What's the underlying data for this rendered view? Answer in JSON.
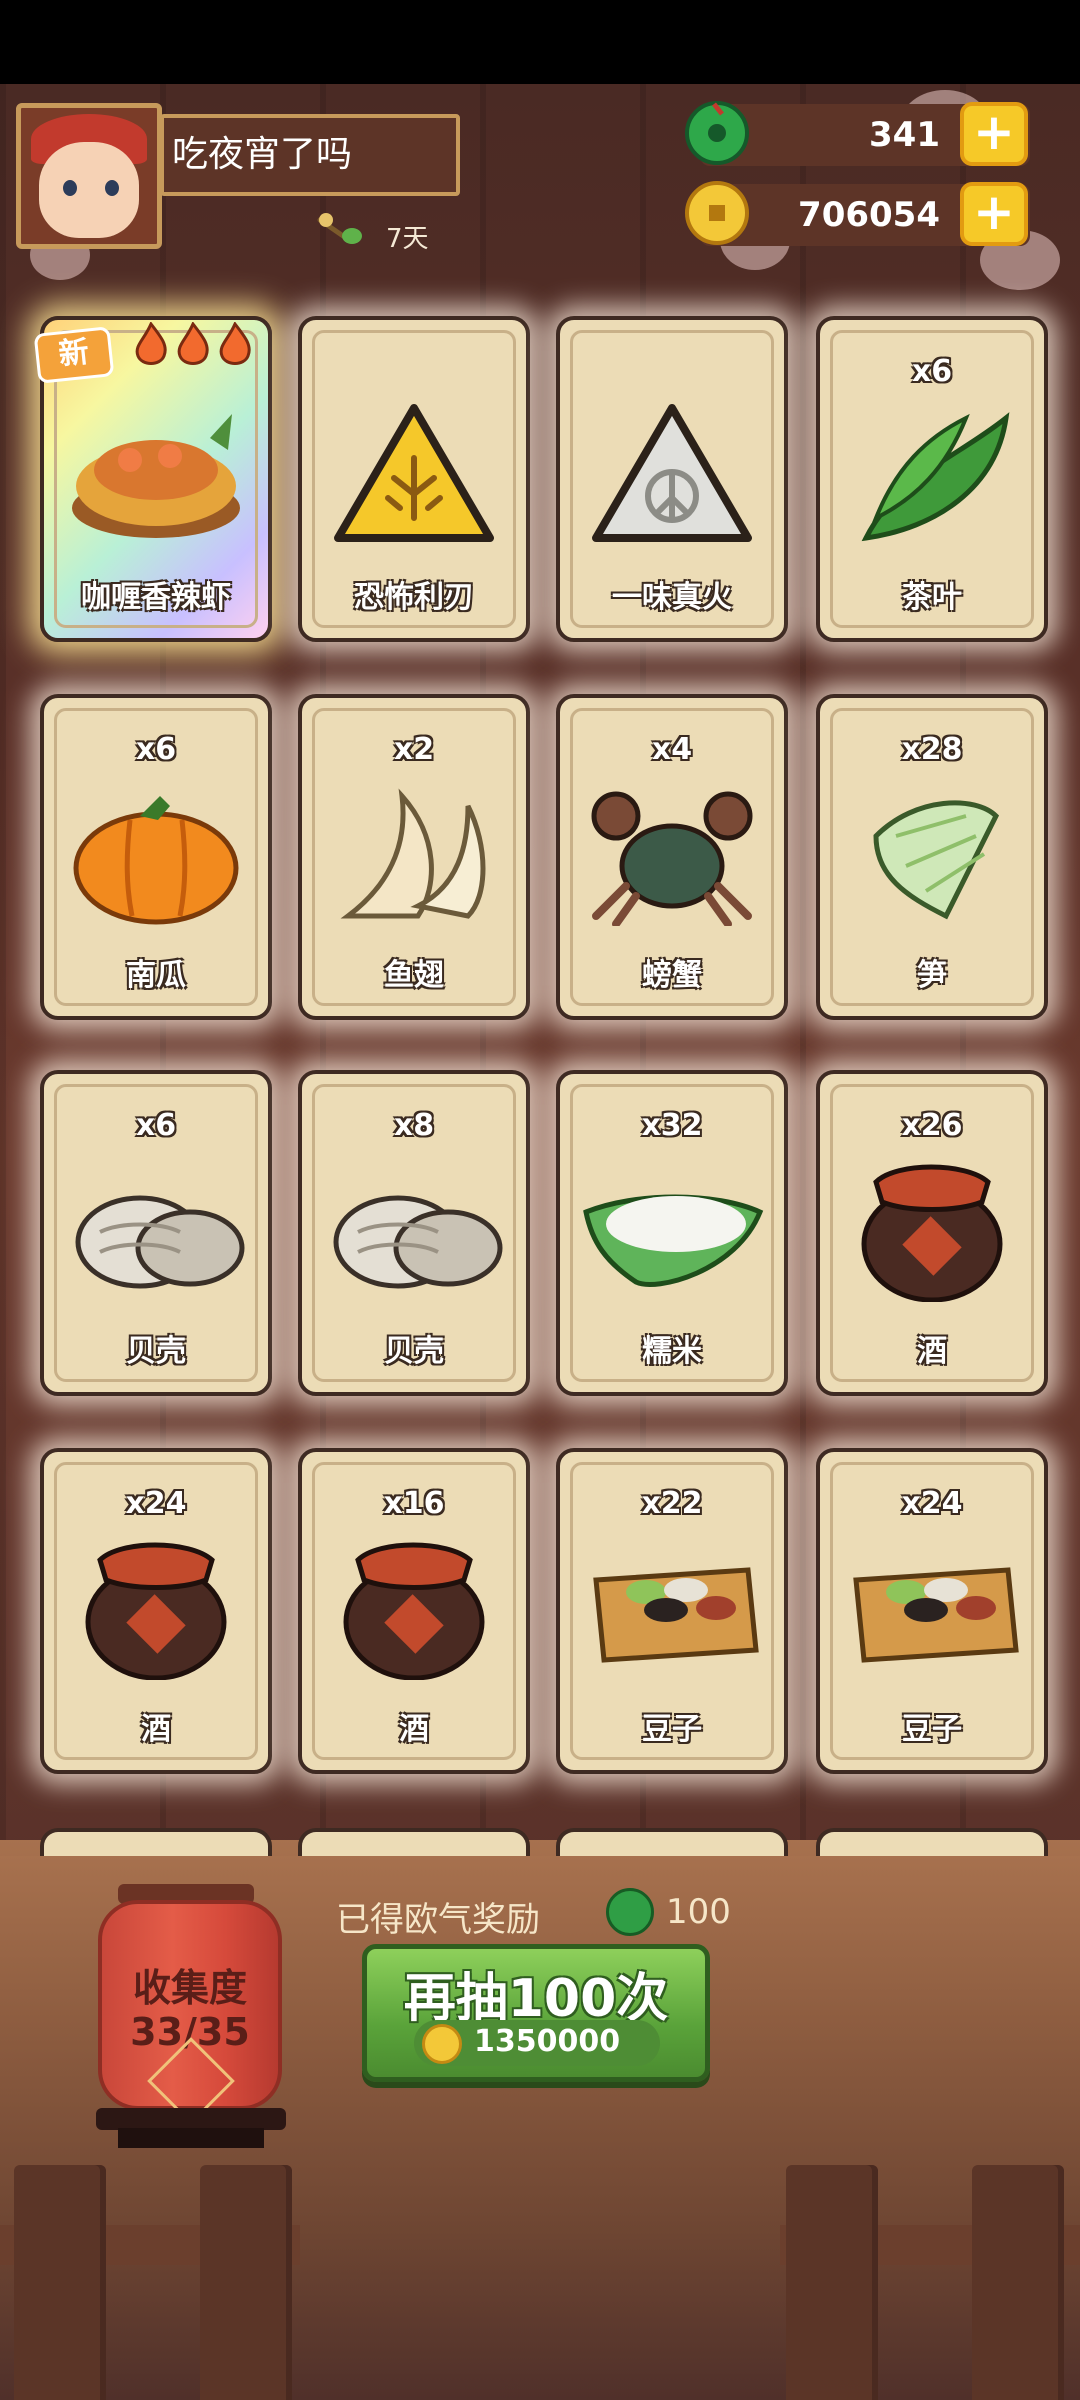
{
  "profile": {
    "name": "吃夜宵了吗",
    "days": "7天"
  },
  "currency": {
    "jade": "341",
    "coins": "706054",
    "plus_label": "+"
  },
  "new_badge": "新",
  "cards": [
    {
      "name": "咖喱香辣虾",
      "count": ""
    },
    {
      "name": "恐怖利刃",
      "count": ""
    },
    {
      "name": "一味真火",
      "count": ""
    },
    {
      "name": "茶叶",
      "count": "x6"
    },
    {
      "name": "南瓜",
      "count": "x6"
    },
    {
      "name": "鱼翅",
      "count": "x2"
    },
    {
      "name": "螃蟹",
      "count": "x4"
    },
    {
      "name": "笋",
      "count": "x28"
    },
    {
      "name": "贝壳",
      "count": "x6"
    },
    {
      "name": "贝壳",
      "count": "x8"
    },
    {
      "name": "糯米",
      "count": "x32"
    },
    {
      "name": "酒",
      "count": "x26"
    },
    {
      "name": "酒",
      "count": "x24"
    },
    {
      "name": "酒",
      "count": "x16"
    },
    {
      "name": "豆子",
      "count": "x22"
    },
    {
      "name": "豆子",
      "count": "x24"
    }
  ],
  "collection": {
    "label": "收集度",
    "progress": "33/35"
  },
  "reward": {
    "label": "已得欧气奖励",
    "amount": "100"
  },
  "draw_button": {
    "label": "再抽100次",
    "cost": "1350000"
  },
  "colors": {
    "card_bg": "#ecdcb6",
    "button_green": "#5aa33a",
    "gold": "#f6c928"
  },
  "icons": {
    "jade": "jade-coin-icon",
    "coin": "gold-coin-icon",
    "plus": "plus-icon",
    "days": "branch-icon",
    "new": "new-icon",
    "flame": "flame-icon"
  }
}
